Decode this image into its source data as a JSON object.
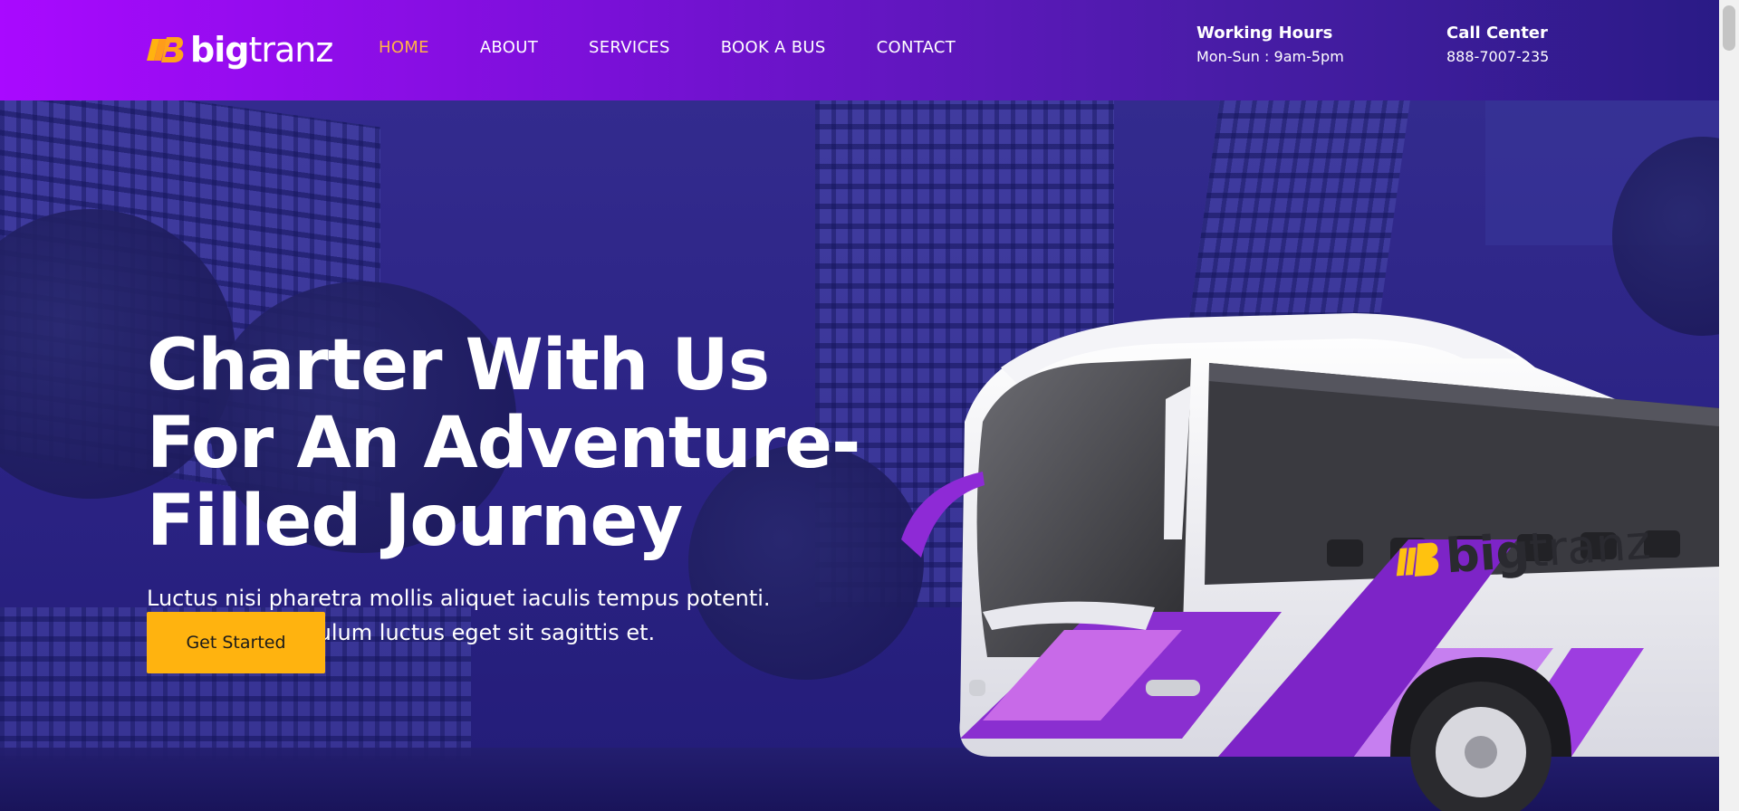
{
  "brand": {
    "name_bold": "big",
    "name_light": "tranz",
    "accent": "#ffb30f",
    "logo_icon": "bus-speed-icon"
  },
  "nav": {
    "items": [
      {
        "label": "HOME",
        "active": true
      },
      {
        "label": "ABOUT",
        "active": false
      },
      {
        "label": "SERVICES",
        "active": false
      },
      {
        "label": "BOOK A BUS",
        "active": false
      },
      {
        "label": "CONTACT",
        "active": false
      }
    ]
  },
  "info": {
    "hours_title": "Working Hours",
    "hours_value": "Mon-Sun : 9am-5pm",
    "call_title": "Call Center",
    "call_value": "888-7007-235"
  },
  "hero": {
    "headline_1": "Charter With Us",
    "headline_2": "For An Adventure-",
    "headline_3": "Filled Journey",
    "sub_1": "Luctus nisi pharetra mollis aliquet iaculis tempus potenti.",
    "sub_2": "Dictumst vestibulum luctus eget sit sagittis et.",
    "cta_label": "Get Started"
  },
  "bus_livery": {
    "name_bold": "big",
    "name_light": "tranz"
  },
  "colors": {
    "header_start": "#a909ff",
    "header_end": "#2a1b86",
    "active_nav": "#ffb347",
    "hero_bg": "#2b2384"
  }
}
